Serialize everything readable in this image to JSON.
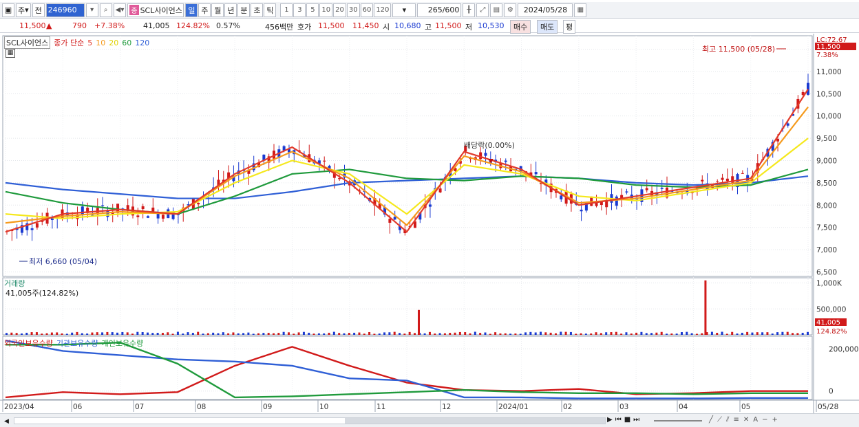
{
  "toolbar": {
    "period_main": "주",
    "prev": "전",
    "stock_code": "246960",
    "stock_name": "SCL사이언스",
    "stock_badge": "종",
    "period_tabs": [
      "일",
      "주",
      "월",
      "년",
      "분",
      "초",
      "틱"
    ],
    "selected_tab": "일",
    "intervals": [
      "1",
      "3",
      "5",
      "10",
      "20",
      "30",
      "60",
      "120"
    ],
    "count": "265",
    "count_total": "/600",
    "date": "2024/05/28"
  },
  "quote": {
    "price": "11,500",
    "up_arrow": "▲",
    "change": "790",
    "change_pct": "+7.38%",
    "volume": "41,005",
    "volume_ratio": "124.82%",
    "turnover": "0.57%",
    "amount": "456백만",
    "bid_label": "호가",
    "ask": "11,500",
    "bid": "11,450",
    "open_label": "시",
    "open": "10,680",
    "high_label": "고",
    "high": "11,500",
    "low_label": "저",
    "low": "10,530",
    "buy": "매수",
    "sell": "매도",
    "eq": "평"
  },
  "colors": {
    "up": "#d11a1a",
    "down": "#1a3ad1",
    "ma5": "#e23a2a",
    "ma10": "#f59a1c",
    "ma20": "#f5e81c",
    "ma60": "#1f9a3c",
    "ma120": "#2f5fd6"
  },
  "price_panel": {
    "legend_name": "SCL사이언스",
    "legend_ma": "종가 단순",
    "ma_periods": [
      "5",
      "10",
      "20",
      "60",
      "120"
    ],
    "lc_label": "LC:72.67",
    "current_price_label": "11,500",
    "current_pct_label": "7.38%",
    "high_annotation": "최고 11,500 (05/28)",
    "low_annotation": "최저 6,660 (05/04)",
    "dividend_annotation": "배당락(0.00%)"
  },
  "volume_panel": {
    "title": "거래량",
    "value_text": "41,005주(124.82%)",
    "current_label": "41,005",
    "current_pct": "124.82%"
  },
  "holdings_panel": {
    "legends": [
      "외국인보유수량",
      "기관보유수량",
      "개인보유수량"
    ]
  },
  "x_labels": [
    "2023/04",
    "06",
    "07",
    "08",
    "09",
    "10",
    "11",
    "12",
    "2024/01",
    "02",
    "03",
    "04",
    "05",
    "05/28"
  ],
  "chart_data": [
    {
      "type": "line",
      "title": "SCL사이언스 종가 단순",
      "ylim": [
        6400,
        11800
      ],
      "yticks": [
        6500,
        7000,
        7500,
        8000,
        8500,
        9000,
        9500,
        10000,
        10500,
        11000,
        11500
      ],
      "ytick_labels": [
        "6,500",
        "7,000",
        "7,500",
        "8,000",
        "8,500",
        "9,000",
        "9,500",
        "10,000",
        "10,500",
        "11,000",
        "11,500"
      ],
      "x": [
        "2023/04",
        "05",
        "06",
        "07",
        "08",
        "09",
        "10",
        "11",
        "12",
        "2024/01",
        "02",
        "03",
        "04",
        "05",
        "05/28"
      ],
      "series": [
        {
          "name": "5",
          "values": [
            7400,
            7800,
            7900,
            7800,
            8700,
            9300,
            8500,
            7400,
            9200,
            8800,
            8000,
            8200,
            8400,
            8600,
            10600
          ]
        },
        {
          "name": "10",
          "values": [
            7600,
            7750,
            7850,
            7800,
            8650,
            9200,
            8600,
            7550,
            9100,
            8750,
            8050,
            8150,
            8350,
            8550,
            10200
          ]
        },
        {
          "name": "20",
          "values": [
            7800,
            7700,
            7800,
            7850,
            8500,
            9000,
            8700,
            7800,
            8900,
            8700,
            8200,
            8100,
            8300,
            8500,
            9500
          ]
        },
        {
          "name": "60",
          "values": [
            8300,
            8050,
            7900,
            7800,
            8200,
            8700,
            8800,
            8600,
            8550,
            8650,
            8600,
            8450,
            8400,
            8450,
            8800
          ]
        },
        {
          "name": "120",
          "values": [
            8500,
            8350,
            8250,
            8150,
            8150,
            8300,
            8500,
            8550,
            8600,
            8650,
            8600,
            8500,
            8450,
            8500,
            8650
          ]
        }
      ]
    },
    {
      "type": "bar",
      "title": "거래량",
      "ylim": [
        0,
        1100000
      ],
      "yticks": [
        500000,
        1000000
      ],
      "ytick_labels": [
        "500,000",
        "1,000K"
      ],
      "spikes": [
        {
          "x": "11",
          "value": 480000
        },
        {
          "x": "04",
          "value": 1050000
        }
      ],
      "baseline_value": 40000
    },
    {
      "type": "line",
      "title": "보유수량",
      "ylim": [
        -40000,
        260000
      ],
      "yticks": [
        0,
        200000
      ],
      "ytick_labels": [
        "0",
        "200,000"
      ],
      "x": [
        "2023/04",
        "05",
        "06",
        "07",
        "08",
        "09",
        "10",
        "11",
        "12",
        "2024/01",
        "02",
        "03",
        "04",
        "05",
        "05/28"
      ],
      "series": [
        {
          "name": "외국인보유수량",
          "values": [
            -30000,
            -5000,
            -15000,
            -5000,
            120000,
            210000,
            120000,
            40000,
            5000,
            0,
            10000,
            -15000,
            -10000,
            0,
            0
          ]
        },
        {
          "name": "기관보유수량",
          "values": [
            240000,
            190000,
            170000,
            150000,
            140000,
            120000,
            60000,
            50000,
            -30000,
            -30000,
            -35000,
            -35000,
            -35000,
            -33000,
            -33000
          ]
        },
        {
          "name": "개인보유수량",
          "values": [
            220000,
            220000,
            230000,
            130000,
            -30000,
            -25000,
            -15000,
            -5000,
            5000,
            -5000,
            -10000,
            -10000,
            -15000,
            -10000,
            -10000
          ]
        }
      ]
    }
  ]
}
